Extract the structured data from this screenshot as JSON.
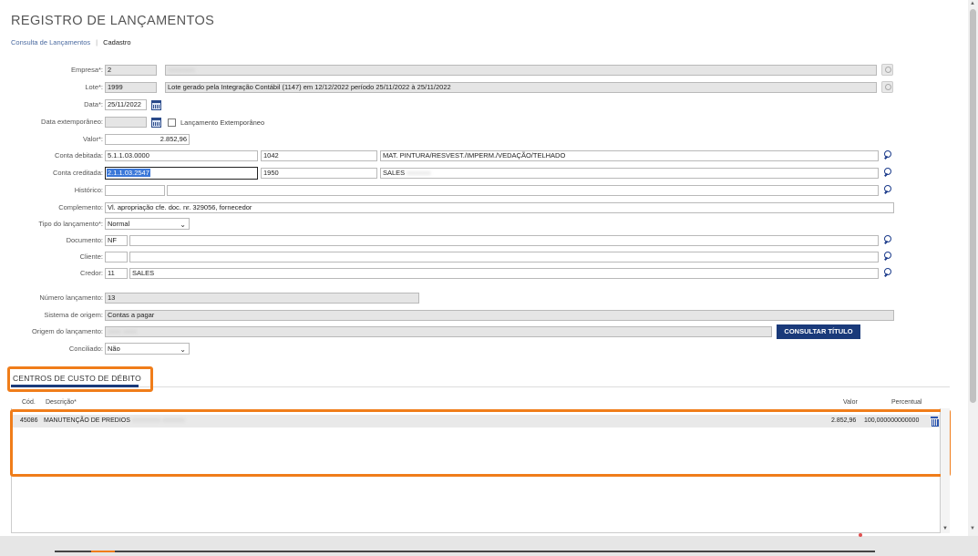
{
  "page": {
    "title": "REGISTRO DE LANÇAMENTOS"
  },
  "breadcrumb": {
    "consulta": "Consulta de Lançamentos",
    "separator": "|",
    "cadastro": "Cadastro"
  },
  "form": {
    "empresa": {
      "label": "Empresa*:",
      "code": "2",
      "name": "xxxxxxxx"
    },
    "lote": {
      "label": "Lote*:",
      "code": "1999",
      "description": "Lote gerado pela Integração Contábil (1147) em 12/12/2022 período 25/11/2022 à 25/11/2022"
    },
    "data": {
      "label": "Data*:",
      "value": "25/11/2022"
    },
    "data_extemporaneo": {
      "label": "Data extemporâneo:",
      "value": "",
      "checkbox_label": "Lançamento Extemporâneo"
    },
    "valor": {
      "label": "Valor*:",
      "value": "2.852,96"
    },
    "conta_debitada": {
      "label": "Conta debitada:",
      "code": "5.1.1.03.0000",
      "reduced": "1042",
      "description": "MAT. PINTURA/RESVEST./IMPERM./VEDAÇÃO/TELHADO"
    },
    "conta_creditada": {
      "label": "Conta creditada:",
      "code": "2.1.1.03.2547",
      "reduced": "1950",
      "description": "SALES",
      "description_blur": "xxxxxxx"
    },
    "historico": {
      "label": "Histórico:",
      "code": "",
      "text": ""
    },
    "complemento": {
      "label": "Complemento:",
      "value": "Vl. apropriação cfe. doc. nr. 329056, fornecedor"
    },
    "tipo_lancamento": {
      "label": "Tipo do lançamento*:",
      "value": "Normal"
    },
    "documento": {
      "label": "Documento:",
      "code": "NF",
      "text": ""
    },
    "cliente": {
      "label": "Cliente:",
      "code": "",
      "text": ""
    },
    "credor": {
      "label": "Credor:",
      "code": "11",
      "name": "SALES"
    },
    "numero_lancamento": {
      "label": "Número lançamento:",
      "value": "13"
    },
    "sistema_origem": {
      "label": "Sistema de origem:",
      "value": "Contas a pagar"
    },
    "origem_lancamento": {
      "label": "Origem do lançamento:",
      "value": "xxxx xxxx",
      "button": "CONSULTAR TÍTULO"
    },
    "conciliado": {
      "label": "Conciliado:",
      "value": "Não"
    }
  },
  "section": {
    "tab_label": "CENTROS DE CUSTO DE DÉBITO",
    "columns": {
      "cod": "Cód.",
      "descricao": "Descrição*",
      "valor": "Valor",
      "percentual": "Percentual"
    },
    "rows": [
      {
        "cod": "45086",
        "descricao": "MANUTENÇÃO DE PREDIOS",
        "descricao_blur": "xxxxxxxxx xxxxxxx",
        "valor": "2.852,96",
        "percentual": "100,000000000000"
      }
    ]
  },
  "colors": {
    "accent": "#1a3a7a",
    "highlight": "#f07d1a",
    "selection": "#3a77d8"
  }
}
